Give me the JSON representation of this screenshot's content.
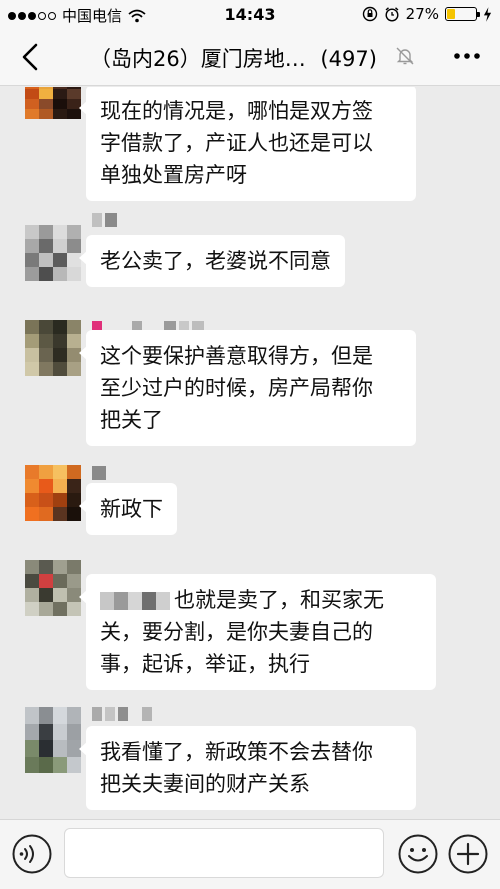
{
  "status_bar": {
    "carrier": "中国电信",
    "time": "14:43",
    "battery": "27%",
    "battery_level": 0.27,
    "icons": [
      "signal-dots-icon",
      "wifi-icon",
      "orientation-lock-icon",
      "alarm-icon",
      "battery-icon",
      "charging-icon"
    ]
  },
  "nav": {
    "title": "（岛内26）厦门房地…",
    "member_count": "(497)",
    "icons": [
      "back-arrow-icon",
      "mute-bell-icon",
      "more-dots-icon"
    ]
  },
  "messages": [
    {
      "text_lines": [
        "现在的情况是，哪怕是双方签",
        "字借款了，产证人也还是可以",
        "单独处置房产呀"
      ]
    },
    {
      "text_lines": [
        "老公卖了，老婆说不同意"
      ]
    },
    {
      "text_lines": [
        "这个要保护善意取得方，但是",
        "至少过户的时候，房产局帮你",
        "把关了"
      ]
    },
    {
      "text_lines": [
        "新政下"
      ]
    },
    {
      "text_lines": [
        "也就是卖了，和买家无",
        "关，要分割，是你夫妻自己的",
        "事，起诉，举证，执行"
      ]
    },
    {
      "text_lines": [
        "我看懂了，新政策不会去替你",
        "把关夫妻间的财产关系"
      ]
    }
  ],
  "input_bar": {
    "icons": [
      "voice-icon",
      "emoji-icon",
      "plus-icon"
    ]
  },
  "colors": {
    "background": "#ebebeb",
    "bubble": "#ffffff",
    "battery_fill": "#f5c400",
    "bar": "#f7f7f7"
  }
}
